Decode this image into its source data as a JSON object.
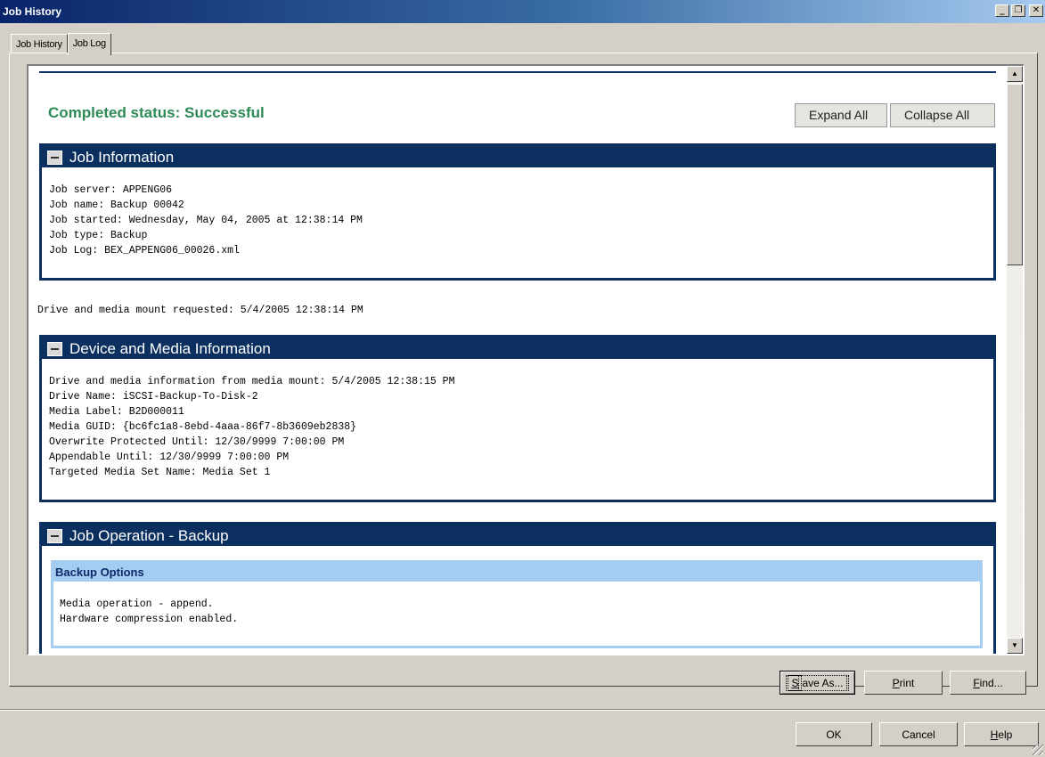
{
  "window": {
    "title": "Job History",
    "buttons": [
      "minimize",
      "restore",
      "close"
    ]
  },
  "tabs": [
    {
      "label": "Job History",
      "active": false
    },
    {
      "label": "Job Log",
      "active": true
    }
  ],
  "log": {
    "status": "Completed status: Successful",
    "status_color": "#2e8b57",
    "header_color": "#0b3060",
    "subheader_color": "#a5cdf2",
    "expand_all": "Expand All",
    "collapse_all": "Collapse All",
    "sections": [
      {
        "title": "Job Information",
        "lines": [
          "Job server: APPENG06",
          "Job name: Backup 00042",
          "Job started: Wednesday, May 04, 2005 at 12:38:14 PM",
          "Job type: Backup",
          "Job Log: BEX_APPENG06_00026.xml"
        ]
      },
      {
        "title": "Device and Media Information",
        "lines": [
          "Drive and media information from media mount: 5/4/2005 12:38:15 PM",
          "Drive Name: iSCSI-Backup-To-Disk-2",
          "Media Label: B2D000011",
          "Media GUID: {bc6fc1a8-8ebd-4aaa-86f7-8b3609eb2838}",
          "Overwrite Protected Until: 12/30/9999 7:00:00 PM",
          "Appendable Until: 12/30/9999 7:00:00 PM",
          "Targeted Media Set Name: Media Set 1"
        ]
      },
      {
        "title": "Job Operation - Backup",
        "subsection": {
          "title": "Backup Options",
          "lines": [
            "Media operation - append.",
            "Hardware compression enabled."
          ]
        }
      }
    ],
    "mount_line": "Drive and media mount requested: 5/4/2005 12:38:14 PM"
  },
  "panel_buttons": {
    "save_as": {
      "label_underline": "S",
      "label_rest": "ave As..."
    },
    "print": {
      "label_underline": "P",
      "label_rest": "rint"
    },
    "find": {
      "label_underline": "F",
      "label_rest": "ind..."
    }
  },
  "dialog_buttons": {
    "ok": "OK",
    "cancel": "Cancel",
    "help": {
      "label_underline": "H",
      "label_rest": "elp"
    }
  }
}
